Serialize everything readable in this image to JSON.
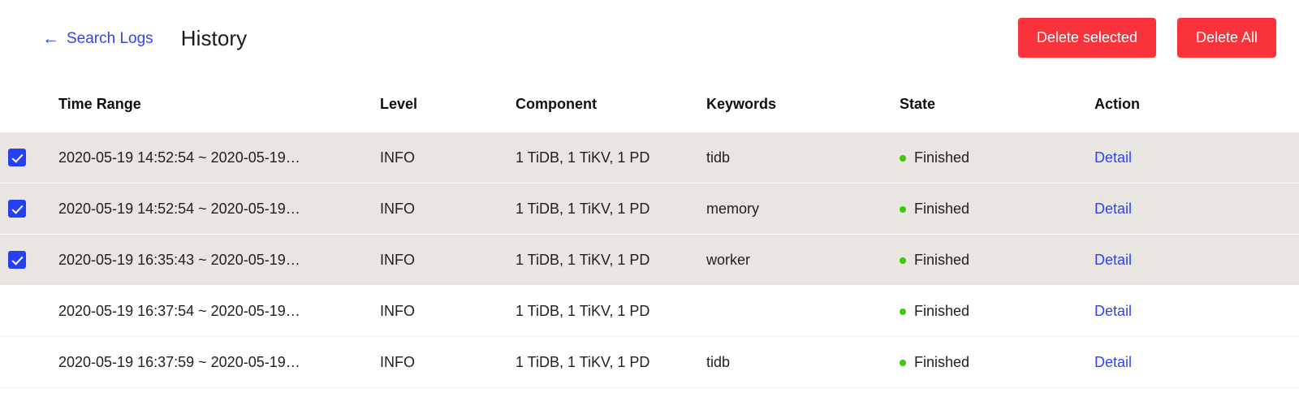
{
  "header": {
    "back_link": "Search Logs",
    "back_arrow_icon": "arrow-left-icon",
    "title": "History",
    "buttons": [
      {
        "label": "Delete selected",
        "color": "#f8333c"
      },
      {
        "label": "Delete All",
        "color": "#f8333c"
      }
    ]
  },
  "table": {
    "columns": [
      {
        "key": "time_range",
        "label": "Time Range"
      },
      {
        "key": "level",
        "label": "Level"
      },
      {
        "key": "component",
        "label": "Component"
      },
      {
        "key": "keywords",
        "label": "Keywords"
      },
      {
        "key": "state",
        "label": "State"
      },
      {
        "key": "action",
        "label": "Action"
      }
    ],
    "rows": [
      {
        "selected": true,
        "time_range": "2020-05-19 14:52:54 ~ 2020-05-19…",
        "level": "INFO",
        "component": "1 TiDB, 1 TiKV, 1 PD",
        "keywords": "tidb",
        "state": "Finished",
        "state_color": "#3fc70a",
        "action": "Detail"
      },
      {
        "selected": true,
        "time_range": "2020-05-19 14:52:54 ~ 2020-05-19…",
        "level": "INFO",
        "component": "1 TiDB, 1 TiKV, 1 PD",
        "keywords": "memory",
        "state": "Finished",
        "state_color": "#3fc70a",
        "action": "Detail"
      },
      {
        "selected": true,
        "time_range": "2020-05-19 16:35:43 ~ 2020-05-19…",
        "level": "INFO",
        "component": "1 TiDB, 1 TiKV, 1 PD",
        "keywords": "worker",
        "state": "Finished",
        "state_color": "#3fc70a",
        "action": "Detail"
      },
      {
        "selected": false,
        "time_range": "2020-05-19 16:37:54 ~ 2020-05-19…",
        "level": "INFO",
        "component": "1 TiDB, 1 TiKV, 1 PD",
        "keywords": "",
        "state": "Finished",
        "state_color": "#3fc70a",
        "action": "Detail"
      },
      {
        "selected": false,
        "time_range": "2020-05-19 16:37:59 ~ 2020-05-19…",
        "level": "INFO",
        "component": "1 TiDB, 1 TiKV, 1 PD",
        "keywords": "tidb",
        "state": "Finished",
        "state_color": "#3fc70a",
        "action": "Detail"
      }
    ]
  },
  "colors": {
    "link": "#2f45f3",
    "danger": "#f8333c",
    "selected_row_bg": "#e9e6e2",
    "checkbox_checked": "#2540f0",
    "state_finished": "#3fc70a"
  }
}
